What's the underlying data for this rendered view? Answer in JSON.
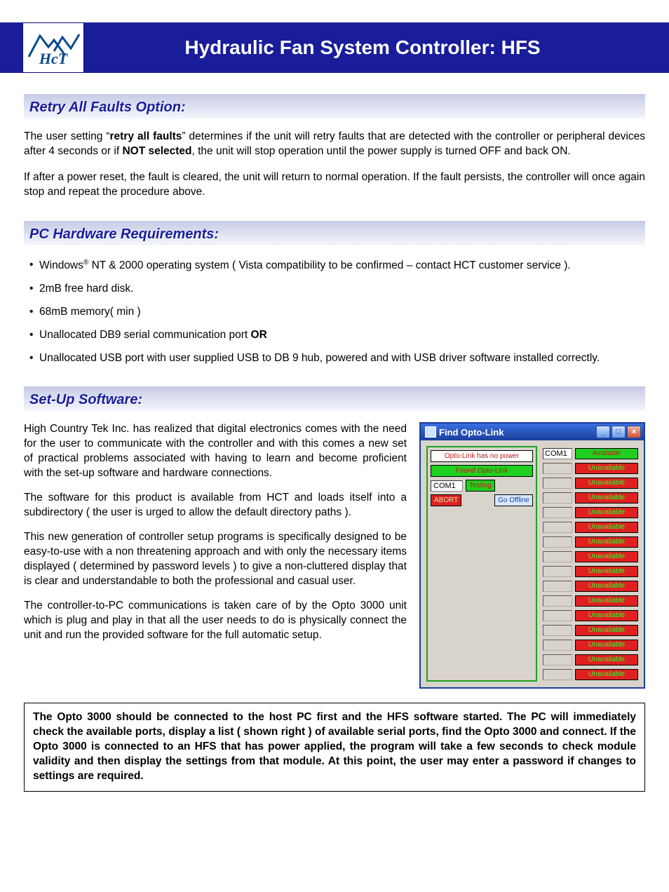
{
  "header": {
    "title": "Hydraulic Fan System Controller: HFS",
    "logo_text": "HcT"
  },
  "sections": {
    "retry": {
      "heading": "Retry All Faults Option:",
      "p1_pre": "The user setting “",
      "p1_bold1": "retry all faults",
      "p1_mid": "” determines if the unit will retry faults that are detected with the controller or peripheral devices after 4 seconds or if ",
      "p1_bold2": "NOT selected",
      "p1_post": ", the unit will stop operation until the power supply is turned OFF and back ON.",
      "p2": "If after a power reset, the fault is cleared, the unit will return to normal operation. If the fault persists, the controller will once again stop and repeat the procedure above."
    },
    "pcreq": {
      "heading": "PC Hardware Requirements:",
      "items": [
        {
          "pre": "Windows",
          "sup": "®",
          "rest": " NT & 2000 operating system ( Vista compatibility to be confirmed  – contact HCT customer service )."
        },
        {
          "text": "2mB free hard disk."
        },
        {
          "text": "68mB memory( min )"
        },
        {
          "pre": "Unallocated DB9 serial communication port ",
          "bold": "OR"
        },
        {
          "text": "Unallocated USB port with user supplied USB to DB 9 hub, powered and with USB driver software installed correctly."
        }
      ]
    },
    "setup": {
      "heading": "Set-Up Software:",
      "paras": [
        "High Country Tek Inc. has realized that digital electronics comes with the need for the user to communicate with the controller and with this comes a new set of practical problems associated with having to learn and become proficient with the set-up software and hardware connections.",
        "The software for this product is available from HCT and loads itself into a subdirectory ( the user is urged to allow the default directory paths ).",
        "This new generation of controller setup programs is specifically designed to be easy-to-use with a non threatening approach and with only the necessary items displayed ( determined by password levels ) to give a non-cluttered display that is clear and understandable to both the professional and casual user.",
        "The controller-to-PC communications is taken care of by the Opto 3000 unit  which is plug and play in that all the user needs to do is physically connect the unit and run the provided software for the full automatic setup."
      ]
    }
  },
  "embedded_window": {
    "title": "Find Opto-Link",
    "nopower": "Opto-Link has no power",
    "found": "Found Opto-Link",
    "com_value": "COM1",
    "testing": "Testing",
    "abort": "ABORT",
    "offline": "Go Offline",
    "ports": [
      {
        "label": "COM1",
        "status": "Available",
        "state": "avail"
      },
      {
        "label": "",
        "status": "Unavailable",
        "state": "unavail"
      },
      {
        "label": "",
        "status": "Unavailable",
        "state": "unavail"
      },
      {
        "label": "",
        "status": "Unavailable",
        "state": "unavail"
      },
      {
        "label": "",
        "status": "Unavailable",
        "state": "unavail"
      },
      {
        "label": "",
        "status": "Unavailable",
        "state": "unavail"
      },
      {
        "label": "",
        "status": "Unavailable",
        "state": "unavail"
      },
      {
        "label": "",
        "status": "Unavailable",
        "state": "unavail"
      },
      {
        "label": "",
        "status": "Unavailable",
        "state": "unavail"
      },
      {
        "label": "",
        "status": "Unavailable",
        "state": "unavail"
      },
      {
        "label": "",
        "status": "Unavailable",
        "state": "unavail"
      },
      {
        "label": "",
        "status": "Unavailable",
        "state": "unavail"
      },
      {
        "label": "",
        "status": "Unavailable",
        "state": "unavail"
      },
      {
        "label": "",
        "status": "Unavailable",
        "state": "unavail"
      },
      {
        "label": "",
        "status": "Unavailable",
        "state": "unavail"
      },
      {
        "label": "",
        "status": "Unavailable",
        "state": "unavail"
      }
    ]
  },
  "note": "The Opto 3000 should be connected to the host PC first and the HFS software started. The PC will immediately check the available ports, display a list ( shown right ) of available serial ports, find the Opto 3000 and connect. If the Opto 3000 is connected to an HFS that has power applied, the program will take a few seconds to check module validity and then display the settings from that module. At this point, the user may enter a password if changes to settings are required."
}
